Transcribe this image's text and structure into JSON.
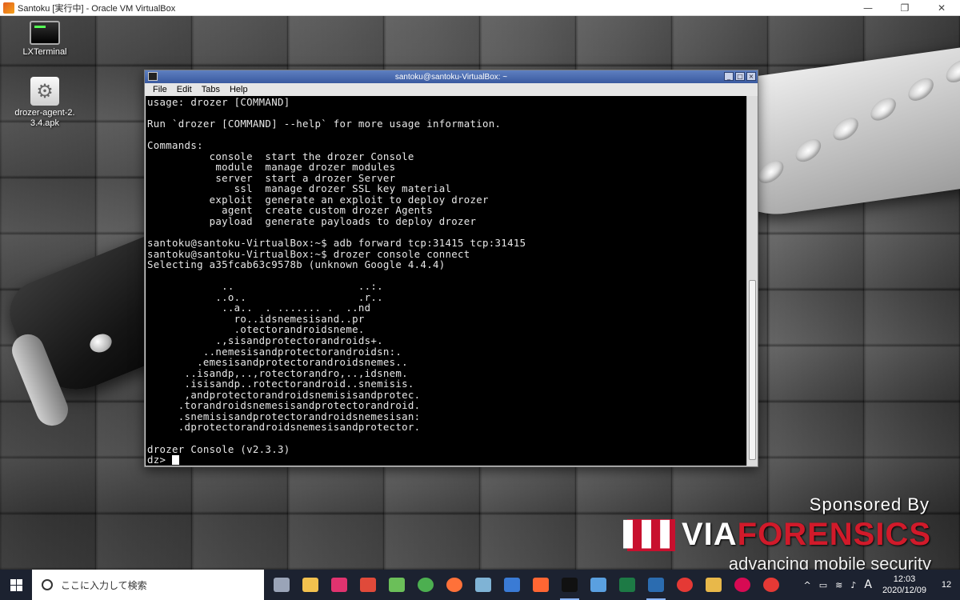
{
  "host": {
    "title": "Santoku [実行中] - Oracle VM VirtualBox",
    "controls": [
      "—",
      "❐",
      "✕"
    ]
  },
  "desktop_icons": [
    {
      "label": "LXTerminal",
      "icon": "terminal-icon"
    },
    {
      "label": "drozer-agent-2.3.4.apk",
      "icon": "apk-gear-icon"
    }
  ],
  "terminal": {
    "title": "santoku@santoku-VirtualBox: ~",
    "menu": [
      "File",
      "Edit",
      "Tabs",
      "Help"
    ],
    "lines": [
      "usage: drozer [COMMAND]",
      "",
      "Run `drozer [COMMAND] --help` for more usage information.",
      "",
      "Commands:",
      "          console  start the drozer Console",
      "           module  manage drozer modules",
      "           server  start a drozer Server",
      "              ssl  manage drozer SSL key material",
      "          exploit  generate an exploit to deploy drozer",
      "            agent  create custom drozer Agents",
      "          payload  generate payloads to deploy drozer",
      "",
      "santoku@santoku-VirtualBox:~$ adb forward tcp:31415 tcp:31415",
      "santoku@santoku-VirtualBox:~$ drozer console connect",
      "Selecting a35fcab63c9578b (unknown Google 4.4.4)",
      "",
      "            ..                    ..:.",
      "           ..o..                  .r..",
      "            ..a..  . ....... .  ..nd",
      "              ro..idsnemesisand..pr",
      "              .otectorandroidsneme.",
      "           .,sisandprotectorandroids+.",
      "         ..nemesisandprotectorandroidsn:.",
      "        .emesisandprotectorandroidsnemes..",
      "      ..isandp,..,rotectorandro,..,idsnem.",
      "      .isisandp..rotectorandroid..snemisis.",
      "      ,andprotectorandroidsnemisisandprotec.",
      "     .torandroidsnemesisandprotectorandroid.",
      "     .snemisisandprotectorandroidsnemesisan:",
      "     .dprotectorandroidsnemesisandprotector.",
      "",
      "drozer Console (v2.3.3)"
    ],
    "prompt": "dz> "
  },
  "sponsor": {
    "by": "Sponsored By",
    "brand_via": "VIA",
    "brand_forensics": "FORENSICS",
    "tagline": "advancing mobile security",
    "brand_color": "#d11a2a"
  },
  "taskbar": {
    "search_placeholder": "ここに入力して検索",
    "apps": [
      {
        "name": "task-view-icon",
        "color": "#9aa4b8"
      },
      {
        "name": "file-explorer-icon",
        "color": "#f2c14e"
      },
      {
        "name": "app-pink-icon",
        "color": "#e0336f"
      },
      {
        "name": "app-red-sync-icon",
        "color": "#e04a3a"
      },
      {
        "name": "app-green-icon",
        "color": "#6bbf59"
      },
      {
        "name": "chrome-icon",
        "color": "#4caf50"
      },
      {
        "name": "firefox-icon",
        "color": "#ff7139"
      },
      {
        "name": "notes-icon",
        "color": "#7fb3d5"
      },
      {
        "name": "wireshark-icon",
        "color": "#3a7bd5"
      },
      {
        "name": "burp-icon",
        "color": "#ff6633"
      },
      {
        "name": "terminal-app-icon",
        "color": "#111111"
      },
      {
        "name": "remote-desktop-icon",
        "color": "#5aa0e0"
      },
      {
        "name": "excel-icon",
        "color": "#1d7a45"
      },
      {
        "name": "virtualbox-icon",
        "color": "#2b6cb0"
      },
      {
        "name": "app-red-circle-icon",
        "color": "#e53935"
      },
      {
        "name": "slack-icon",
        "color": "#e8b84a"
      },
      {
        "name": "debian-icon",
        "color": "#d70a53"
      },
      {
        "name": "app-oo-icon",
        "color": "#e53935"
      }
    ],
    "tray_icons": [
      "^",
      "▭",
      "≋",
      "♪",
      "A"
    ],
    "time": "12:03",
    "date": "2020/12/09",
    "notifications": "12"
  }
}
